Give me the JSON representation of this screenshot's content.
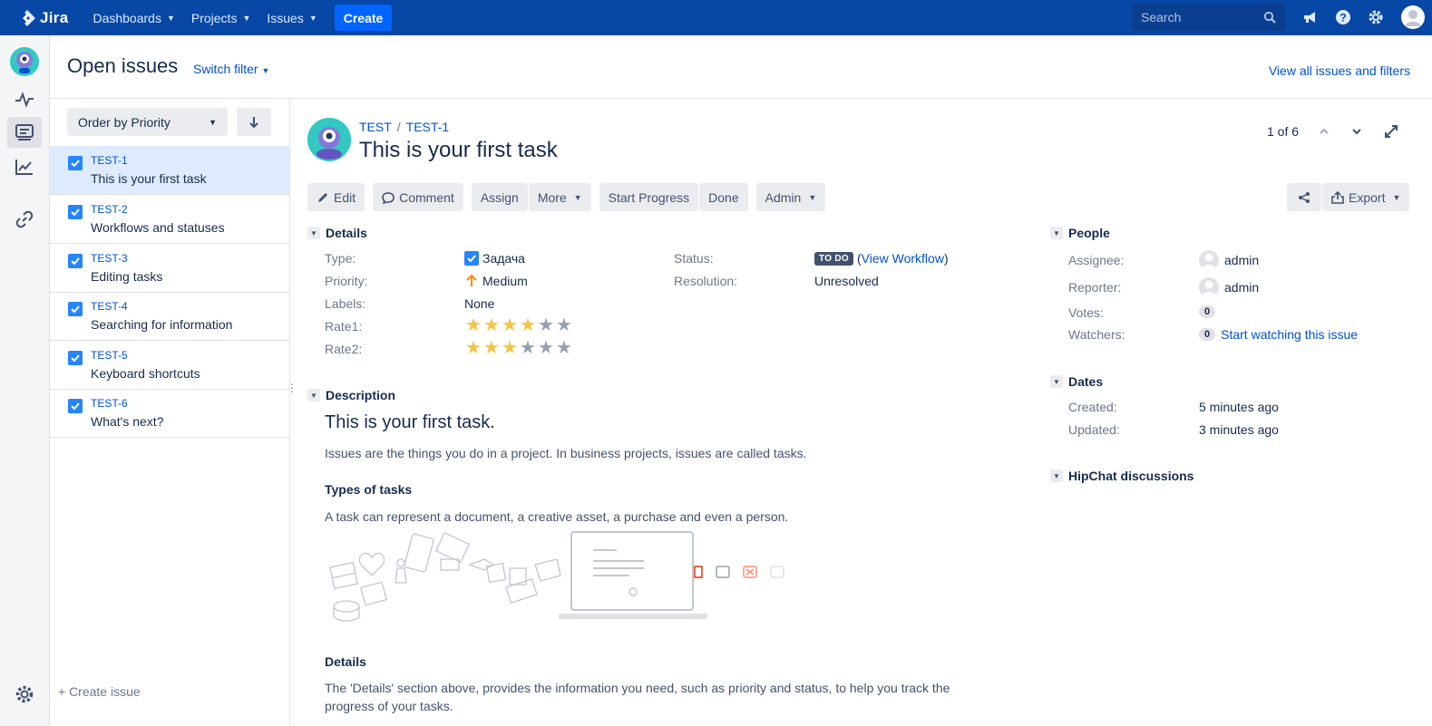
{
  "topnav": {
    "brand": "Jira",
    "items": [
      {
        "label": "Dashboards"
      },
      {
        "label": "Projects"
      },
      {
        "label": "Issues"
      }
    ],
    "create_label": "Create",
    "search_placeholder": "Search"
  },
  "header": {
    "title": "Open issues",
    "switch_filter": "Switch filter",
    "view_all": "View all issues and filters"
  },
  "list": {
    "order_label": "Order by Priority",
    "issues": [
      {
        "key": "TEST-1",
        "summary": "This is your first task"
      },
      {
        "key": "TEST-2",
        "summary": "Workflows and statuses"
      },
      {
        "key": "TEST-3",
        "summary": "Editing tasks"
      },
      {
        "key": "TEST-4",
        "summary": "Searching for information"
      },
      {
        "key": "TEST-5",
        "summary": "Keyboard shortcuts"
      },
      {
        "key": "TEST-6",
        "summary": "What's next?"
      }
    ],
    "create_issue": "+ Create issue"
  },
  "issue": {
    "project": "TEST",
    "key": "TEST-1",
    "title": "This is your first task",
    "pager": "1 of 6",
    "toolbar": {
      "edit": "Edit",
      "comment": "Comment",
      "assign": "Assign",
      "more": "More",
      "start_progress": "Start Progress",
      "done": "Done",
      "admin": "Admin",
      "export": "Export"
    },
    "details": {
      "heading": "Details",
      "type_label": "Type:",
      "type_value": "Задача",
      "priority_label": "Priority:",
      "priority_value": "Medium",
      "labels_label": "Labels:",
      "labels_value": "None",
      "rate1_label": "Rate1:",
      "rate1_value": 4,
      "rate2_label": "Rate2:",
      "rate2_value": 3,
      "status_label": "Status:",
      "status_value": "TO DO",
      "view_workflow": "View Workflow",
      "resolution_label": "Resolution:",
      "resolution_value": "Unresolved"
    },
    "description": {
      "heading": "Description",
      "h1": "This is your first task.",
      "p1": "Issues are the things you do in a project. In business projects, issues are called tasks.",
      "h3a": "Types of tasks",
      "p2": "A task can represent a document, a creative asset, a purchase and even a person.",
      "h3b": "Details",
      "p3": "The 'Details' section above, provides the information you need, such as priority and status, to help you track the progress of your tasks."
    },
    "people": {
      "heading": "People",
      "assignee_label": "Assignee:",
      "assignee_value": "admin",
      "reporter_label": "Reporter:",
      "reporter_value": "admin",
      "votes_label": "Votes:",
      "votes_value": "0",
      "watchers_label": "Watchers:",
      "watchers_value": "0",
      "watch_link": "Start watching this issue"
    },
    "dates": {
      "heading": "Dates",
      "created_label": "Created:",
      "created_value": "5 minutes ago",
      "updated_label": "Updated:",
      "updated_value": "3 minutes ago"
    },
    "hipchat_heading": "HipChat discussions"
  },
  "colors": {
    "nav_bg": "#0747a6",
    "link": "#0052cc",
    "selected_bg": "#deebff",
    "checkbox": "#2684ff",
    "star_on": "#f5c342"
  }
}
